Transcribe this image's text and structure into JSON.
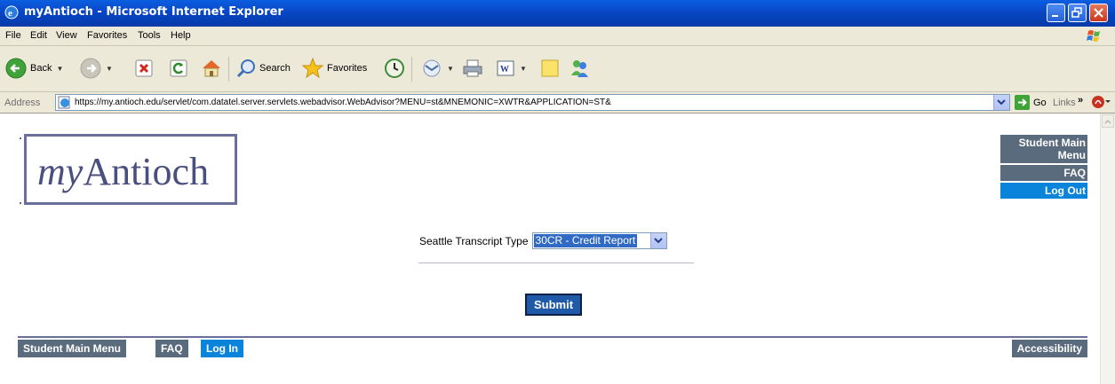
{
  "window": {
    "title": "myAntioch - Microsoft Internet Explorer"
  },
  "menu": {
    "items": [
      "File",
      "Edit",
      "View",
      "Favorites",
      "Tools",
      "Help"
    ]
  },
  "toolbar": {
    "back_label": "Back",
    "search_label": "Search",
    "favorites_label": "Favorites"
  },
  "address": {
    "label": "Address",
    "url": "https://my.antioch.edu/servlet/com.datatel.server.servlets.webadvisor.WebAdvisor?MENU=st&MNEMONIC=XWTR&APPLICATION=ST&",
    "go_label": "Go",
    "links_label": "Links"
  },
  "page": {
    "logo_prefix": "my",
    "logo_suffix": "Antioch",
    "side_menu": {
      "student_main_menu": "Student Main Menu",
      "faq": "FAQ",
      "log_out": "Log Out"
    },
    "form": {
      "label": "Seattle Transcript Type",
      "selected_value": "30CR - Credit Report",
      "submit_label": "Submit"
    },
    "footer": {
      "student_main_menu": "Student Main Menu",
      "faq": "FAQ",
      "log_in": "Log In",
      "accessibility": "Accessibility"
    }
  },
  "colors": {
    "nav_gray": "#5b6b7e",
    "nav_active": "#0a83db",
    "submit_blue": "#1f5aa8",
    "logo_border": "#6a6e9a"
  }
}
